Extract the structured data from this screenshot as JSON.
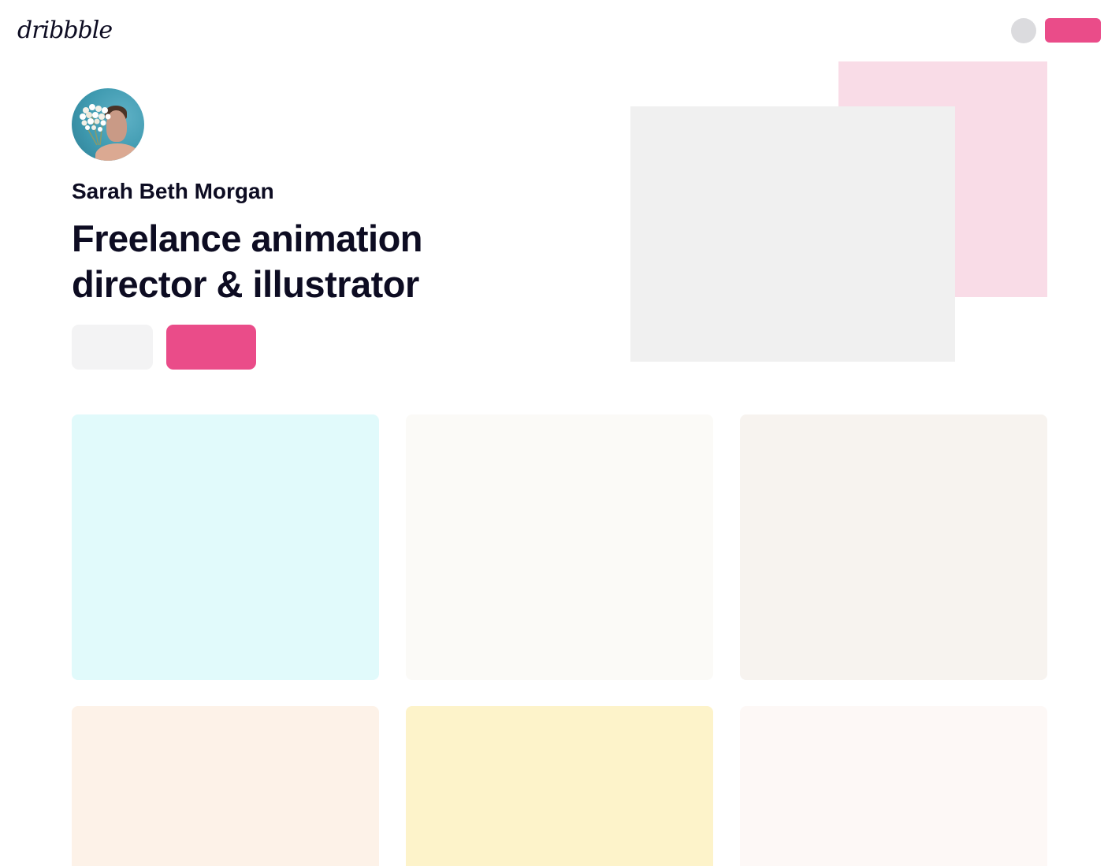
{
  "header": {
    "logo_text": "dribbble"
  },
  "profile": {
    "name": "Sarah Beth Morgan",
    "headline": "Freelance animation director & illustrator"
  },
  "colors": {
    "accent": "#ea4c89",
    "hero_back": "#f9dce7",
    "hero_front": "#f0f0f0",
    "shots": [
      "#e1fafb",
      "#fbfaf7",
      "#f7f3ef",
      "#fdf2e8",
      "#fdf3ca",
      "#fdf8f6"
    ]
  },
  "shots_count": 6
}
